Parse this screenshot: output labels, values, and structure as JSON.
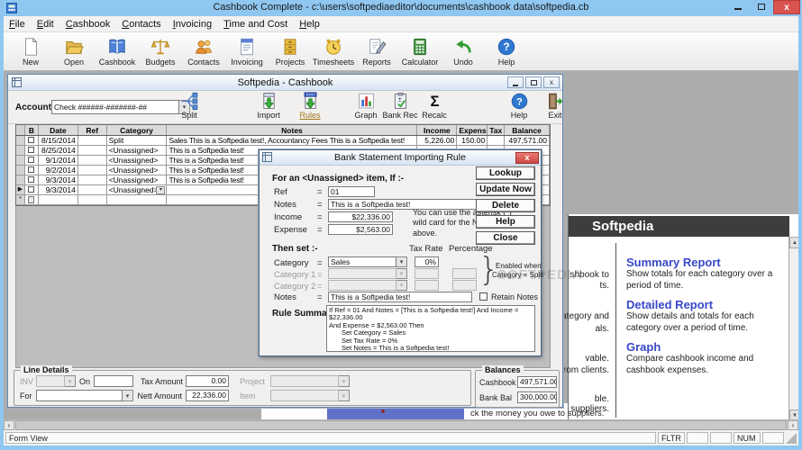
{
  "window": {
    "title": "Cashbook Complete - c:\\users\\softpediaeditor\\documents\\cashbook data\\softpedia.cb"
  },
  "glyphs": {
    "combo_arrow": "▾",
    "close_x": "x",
    "question": "?",
    "sigma": "Σ",
    "plus_minus": "±",
    "scroll_left": "‹",
    "scroll_right": "›",
    "scroll_up": "▲",
    "scroll_down": "▼"
  },
  "menu": {
    "items": [
      "File",
      "Edit",
      "Cashbook",
      "Contacts",
      "Invoicing",
      "Time and Cost",
      "Help"
    ]
  },
  "toolbar": {
    "items": [
      {
        "label": "New"
      },
      {
        "label": "Open"
      },
      {
        "label": "Cashbook"
      },
      {
        "label": "Budgets"
      },
      {
        "label": "Contacts"
      },
      {
        "label": "Invoicing"
      },
      {
        "label": "Projects"
      },
      {
        "label": "Timesheets"
      },
      {
        "label": "Reports"
      },
      {
        "label": "Calculator"
      },
      {
        "label": "Undo"
      },
      {
        "label": "Help"
      }
    ]
  },
  "cashbook": {
    "title": "Softpedia - Cashbook",
    "account_label": "Account",
    "account_value": "Check ######-#######-##",
    "tools": [
      "Split",
      "Import",
      "Rules",
      "Graph",
      "Bank Rec",
      "Recalc",
      "Help",
      "Exit"
    ],
    "table": {
      "headers": [
        "B",
        "Date",
        "Ref",
        "Category",
        "Notes",
        "Income",
        "Expense",
        "Tax",
        "Balance"
      ],
      "rows": [
        {
          "selector": "",
          "date": "8/15/2014",
          "ref": "",
          "category": "Split",
          "notes": "Sales This is a Softpedia test!, Accountancy Fees This is a Softpedia test!",
          "income": "5,226.00",
          "expense": "150.00",
          "tax": "",
          "balance": "497,571.00",
          "checkbox": true,
          "dropdown": false,
          "is_new": false
        },
        {
          "selector": "",
          "date": "8/25/2014",
          "ref": "",
          "category": "<Unassigned>",
          "notes": "This is a Softpedia test!",
          "income": "",
          "expense": "",
          "tax": "",
          "balance": "",
          "checkbox": true,
          "dropdown": false,
          "is_new": false
        },
        {
          "selector": "",
          "date": "9/1/2014",
          "ref": "",
          "category": "<Unassigned>",
          "notes": "This is a Softpedia test!",
          "income": "",
          "expense": "",
          "tax": "",
          "balance": "",
          "checkbox": true,
          "dropdown": false,
          "is_new": false
        },
        {
          "selector": "",
          "date": "9/2/2014",
          "ref": "",
          "category": "<Unassigned>",
          "notes": "This is a Softpedia test!",
          "income": "",
          "expense": "",
          "tax": "",
          "balance": "",
          "checkbox": true,
          "dropdown": false,
          "is_new": false
        },
        {
          "selector": "",
          "date": "9/3/2014",
          "ref": "",
          "category": "<Unassigned>",
          "notes": "This is a Softpedia test!",
          "income": "",
          "expense": "",
          "tax": "",
          "balance": "",
          "checkbox": true,
          "dropdown": false,
          "is_new": false
        },
        {
          "selector": "▶",
          "date": "9/3/2014",
          "ref": "",
          "category": "<Unassigned>",
          "notes": "",
          "income": "",
          "expense": "",
          "tax": "",
          "balance": "",
          "checkbox": true,
          "dropdown": true,
          "is_new": false
        },
        {
          "selector": "*",
          "date": "",
          "ref": "",
          "category": "",
          "notes": "",
          "income": "",
          "expense": "",
          "tax": "",
          "balance": "",
          "checkbox": false,
          "dropdown": false,
          "is_new": true
        }
      ]
    },
    "line_details": {
      "title": "Line Details",
      "inv_label": "INV",
      "on_label": "On",
      "for_label": "For",
      "tax_label": "Tax Amount",
      "tax_value": "0.00",
      "nett_label": "Nett Amount",
      "nett_value": "22,336.00",
      "project_label": "Project",
      "item_label": "Item"
    },
    "balances": {
      "title": "Balances",
      "cashbook_label": "Cashbook",
      "cashbook_value": "497,571.00",
      "bank_label": "Bank Bal",
      "bank_value": "300,000.00"
    }
  },
  "dialog": {
    "title": "Bank Statement Importing Rule",
    "if_heading": "For an <Unassigned> item,  If :-",
    "eq": "=",
    "ref_label": "Ref",
    "ref_value": "01",
    "notes_label": "Notes",
    "notes_value": "This is a Softpedia test!",
    "income_label": "Income",
    "income_value": "$22,336.00",
    "expense_label": "Expense",
    "expense_value": "$2,563.00",
    "hint": "You can use the asterisk (*) wild card for the Notes field above.",
    "buttons": [
      "Lookup",
      "Update Now",
      "Delete",
      "Help",
      "Close"
    ],
    "then_heading": "Then set :-",
    "tax_rate_header": "Tax Rate",
    "percentage_header": "Percentage",
    "category_label": "Category",
    "category_value": "Sales",
    "category_tax": "0%",
    "category1_label": "Category 1",
    "category2_label": "Category 2",
    "enabled_line1": "Enabled when",
    "enabled_line2": "Category = Split",
    "set_notes_label": "Notes",
    "set_notes_value": "This is a Softpedia test!",
    "retain_label": "Retain Notes",
    "summary_label": "Rule Summary",
    "summary_lines": [
      "If Ref = 01 And Notes = [This is a Softpedia test!] And Income = $22,336.00",
      "And Expense = $2,563.00 Then",
      "Set Category = Sales",
      "Set Tax Rate = 0%",
      "Set Notes = This is a Softpedia test!"
    ]
  },
  "home_panel": {
    "banner": "Softpedia",
    "links": [
      {
        "title": "Summary Report",
        "desc": "Show totals for each category over a period of time."
      },
      {
        "title": "Detailed Report",
        "desc": "Show details and totals for each category over a period of time."
      },
      {
        "title": "Graph",
        "desc": "Compare cashbook income and cashbook expenses."
      }
    ],
    "fragments": [
      "shbook to",
      "ts.",
      "ategory and",
      "als.",
      "vable.",
      "rom clients.",
      "ble.",
      "to suppliers."
    ]
  },
  "background": {
    "owe_fragment": "ck the money you owe to suppliers."
  },
  "status": {
    "view": "Form View",
    "fltr": "FLTR",
    "num": "NUM"
  },
  "watermark": "SOFTPEDIA"
}
